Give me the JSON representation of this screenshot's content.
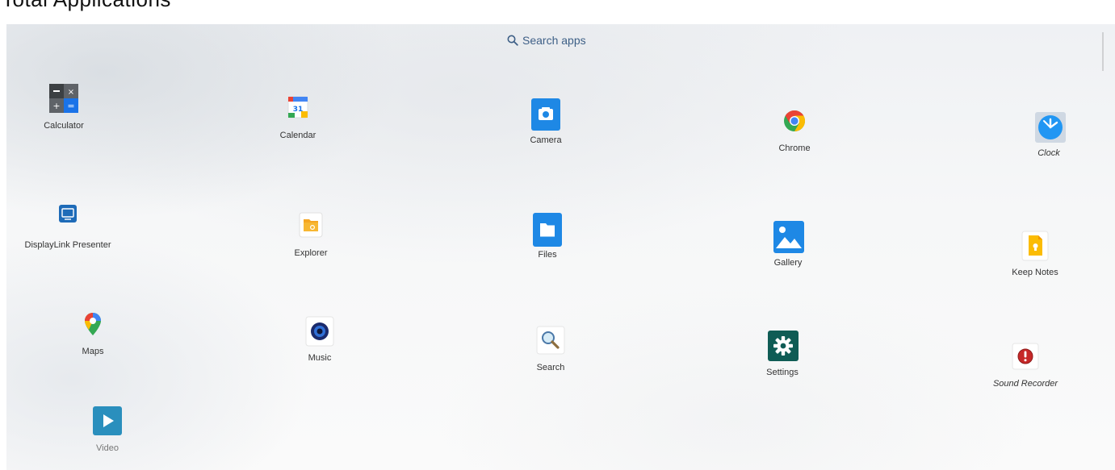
{
  "header": {
    "cut_off_title": "Total Applications"
  },
  "search": {
    "label": "Search apps",
    "color": "#3d5f86"
  },
  "apps": [
    {
      "label": "Calculator",
      "icon": "calculator-icon",
      "color": "#1a73e8"
    },
    {
      "label": "Calendar",
      "icon": "calendar-icon",
      "color": "#4285f4"
    },
    {
      "label": "Camera",
      "icon": "camera-icon",
      "color": "#1e88e5"
    },
    {
      "label": "Chrome",
      "icon": "chrome-icon",
      "color": "#ea4335"
    },
    {
      "label": "Clock",
      "icon": "clock-icon",
      "color": "#2196f3"
    },
    {
      "label": "DisplayLink Presenter",
      "icon": "displaylink-icon",
      "color": "#1e6bb8"
    },
    {
      "label": "Explorer",
      "icon": "explorer-folder-icon",
      "color": "#f5a623"
    },
    {
      "label": "Files",
      "icon": "files-folder-icon",
      "color": "#1e88e5"
    },
    {
      "label": "Gallery",
      "icon": "gallery-icon",
      "color": "#1e88e5"
    },
    {
      "label": "Keep Notes",
      "icon": "keep-notes-icon",
      "color": "#fbbc04"
    },
    {
      "label": "Maps",
      "icon": "maps-pin-icon",
      "color": "#34a853"
    },
    {
      "label": "Music",
      "icon": "music-icon",
      "color": "#1a2a6c"
    },
    {
      "label": "Search",
      "icon": "magnifier-icon",
      "color": "#4a78a8"
    },
    {
      "label": "Settings",
      "icon": "settings-gear-icon",
      "color": "#0f5c55"
    },
    {
      "label": "Sound Recorder",
      "icon": "sound-recorder-icon",
      "color": "#c62828"
    },
    {
      "label": "Video",
      "icon": "video-play-icon",
      "color": "#2a8fbd"
    }
  ]
}
